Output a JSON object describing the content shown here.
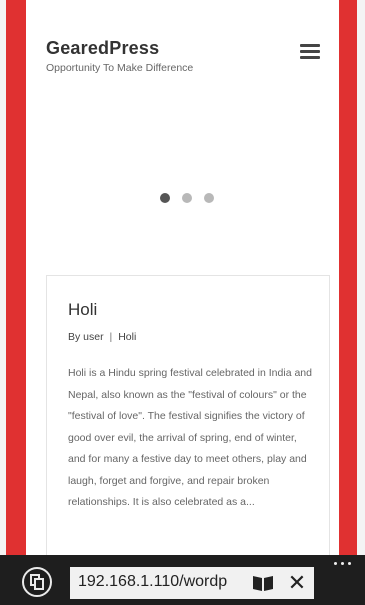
{
  "site": {
    "title": "GearedPress",
    "tagline": "Opportunity To Make Difference"
  },
  "slider": {
    "dots": 3,
    "active_index": 0
  },
  "post": {
    "title": "Holi",
    "author": "By user",
    "separator": "|",
    "category": "Holi",
    "excerpt": "Holi  is a Hindu spring festival celebrated in India and Nepal, also known as the \"festival of colours\" or the \"festival of love\". The festival signifies the victory of good over evil, the arrival of spring, end of winter, and for many a festive day to meet others, play and laugh, forget and forgive, and repair broken relationships. It is also celebrated as a..."
  },
  "browser": {
    "address": "192.168.1.110/wordp",
    "close_label": "✕"
  },
  "colors": {
    "side_accent": "#e03131",
    "bottom_bar": "#1e1e1e"
  }
}
